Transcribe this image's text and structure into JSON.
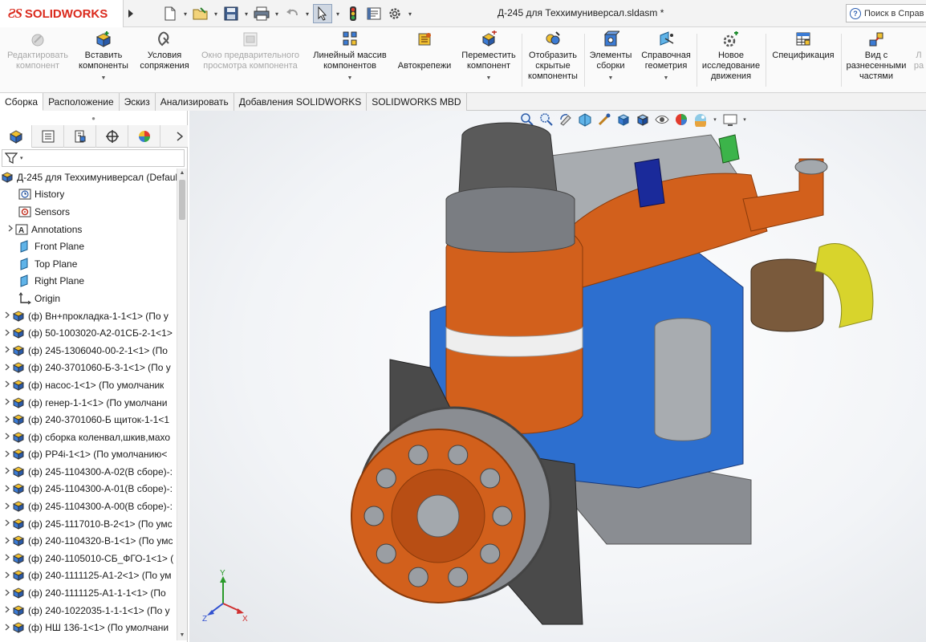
{
  "app": {
    "logo_mark": "ƧS",
    "logo_text": "SOLIDWORKS",
    "document_title": "Д-245 для Теххимуниверсал.sldasm *",
    "help_search_placeholder": "Поиск в Справ"
  },
  "quick_access": {
    "icons": [
      "new-document-icon",
      "open-folder-icon",
      "save-icon",
      "print-icon",
      "undo-icon",
      "select-pointer-icon",
      "rebuild-icon",
      "file-properties-icon",
      "options-gear-icon"
    ]
  },
  "ribbon": {
    "buttons": [
      {
        "label": "Редактировать\nкомпонент",
        "icon": "edit-component-icon",
        "enabled": false,
        "dropdown": false
      },
      {
        "label": "Вставить\nкомпоненты",
        "icon": "insert-components-icon",
        "enabled": true,
        "dropdown": true
      },
      {
        "label": "Условия\nсопряжения",
        "icon": "mate-icon",
        "enabled": true,
        "dropdown": false
      },
      {
        "label": "Окно предварительного\nпросмотра компонента",
        "icon": "component-preview-icon",
        "enabled": false,
        "dropdown": false
      },
      {
        "label": "Линейный массив\nкомпонентов",
        "icon": "linear-pattern-icon",
        "enabled": true,
        "dropdown": true
      },
      {
        "label": "Автокрепежи",
        "icon": "smart-fasteners-icon",
        "enabled": true,
        "dropdown": false
      },
      {
        "label": "Переместить\nкомпонент",
        "icon": "move-component-icon",
        "enabled": true,
        "dropdown": true
      },
      {
        "label": "Отобразить\nскрытые\nкомпоненты",
        "icon": "show-hidden-components-icon",
        "enabled": true,
        "dropdown": false
      },
      {
        "label": "Элементы\nсборки",
        "icon": "assembly-features-icon",
        "enabled": true,
        "dropdown": true
      },
      {
        "label": "Справочная\nгеометрия",
        "icon": "reference-geometry-icon",
        "enabled": true,
        "dropdown": true
      },
      {
        "label": "Новое\nисследование\nдвижения",
        "icon": "motion-study-icon",
        "enabled": true,
        "dropdown": false
      },
      {
        "label": "Спецификация",
        "icon": "bill-of-materials-icon",
        "enabled": true,
        "dropdown": false
      },
      {
        "label": "Вид с\nразнесенными\nчастями",
        "icon": "exploded-view-icon",
        "enabled": true,
        "dropdown": false
      },
      {
        "label": "Л\nра",
        "icon": "partial-tool-icon",
        "enabled": false,
        "dropdown": false
      }
    ]
  },
  "command_tabs": [
    {
      "label": "Сборка",
      "active": true
    },
    {
      "label": "Расположение",
      "active": false
    },
    {
      "label": "Эскиз",
      "active": false
    },
    {
      "label": "Анализировать",
      "active": false
    },
    {
      "label": "Добавления SOLIDWORKS",
      "active": false
    },
    {
      "label": "SOLIDWORKS MBD",
      "active": false
    }
  ],
  "manager_tabs": [
    "feature-manager-icon",
    "property-manager-icon",
    "configuration-manager-icon",
    "dimxpert-manager-icon",
    "display-manager-icon"
  ],
  "tree": {
    "root": "Д-245 для Теххимуниверсал  (Default",
    "items": [
      {
        "label": "History",
        "icon": "history-icon",
        "expandable": false
      },
      {
        "label": "Sensors",
        "icon": "sensors-icon",
        "expandable": false
      },
      {
        "label": "Annotations",
        "icon": "annotations-icon",
        "expandable": true
      },
      {
        "label": "Front Plane",
        "icon": "plane-icon",
        "expandable": false
      },
      {
        "label": "Top Plane",
        "icon": "plane-icon",
        "expandable": false
      },
      {
        "label": "Right Plane",
        "icon": "plane-icon",
        "expandable": false
      },
      {
        "label": "Origin",
        "icon": "origin-icon",
        "expandable": false
      },
      {
        "label": "(ф) Вн+прокладка-1-1<1> (По у",
        "icon": "component-icon",
        "expandable": true
      },
      {
        "label": "(ф) 50-1003020-А2-01СБ-2-1<1>",
        "icon": "component-icon",
        "expandable": true
      },
      {
        "label": "(ф) 245-1306040-00-2-1<1> (По",
        "icon": "component-icon",
        "expandable": true
      },
      {
        "label": "(ф) 240-3701060-Б-3-1<1> (По у",
        "icon": "component-icon",
        "expandable": true
      },
      {
        "label": "(ф) насос-1<1> (По умолчаник",
        "icon": "component-icon",
        "expandable": true
      },
      {
        "label": "(ф) генер-1-1<1> (По умолчани",
        "icon": "component-icon",
        "expandable": true
      },
      {
        "label": "(ф) 240-3701060-Б щиток-1-1<1",
        "icon": "component-icon",
        "expandable": true
      },
      {
        "label": "(ф) сборка коленвал,шкив,махо",
        "icon": "component-icon",
        "expandable": true
      },
      {
        "label": "(ф) PP4i-1<1> (По умолчанию<",
        "icon": "component-icon",
        "expandable": true
      },
      {
        "label": "(ф) 245-1104300-А-02(В сборе)-:",
        "icon": "component-icon",
        "expandable": true
      },
      {
        "label": "(ф) 245-1104300-А-01(В сборе)-:",
        "icon": "component-icon",
        "expandable": true
      },
      {
        "label": "(ф) 245-1104300-А-00(В сборе)-:",
        "icon": "component-icon",
        "expandable": true
      },
      {
        "label": "(ф) 245-1117010-В-2<1> (По умс",
        "icon": "component-icon",
        "expandable": true
      },
      {
        "label": "(ф) 240-1104320-В-1<1> (По умс",
        "icon": "component-icon",
        "expandable": true
      },
      {
        "label": "(ф) 240-1105010-СБ_ФГО-1<1> (",
        "icon": "component-icon",
        "expandable": true
      },
      {
        "label": "(ф) 240-1111125-А1-2<1> (По ум",
        "icon": "component-icon",
        "expandable": true
      },
      {
        "label": "(ф) 240-1111125-А1-1-1<1> (По",
        "icon": "component-icon",
        "expandable": true
      },
      {
        "label": "(ф) 240-1022035-1-1-1<1> (По у",
        "icon": "component-icon",
        "expandable": true
      },
      {
        "label": "(ф) НШ 136-1<1> (По умолчани",
        "icon": "component-icon",
        "expandable": true
      }
    ]
  },
  "viewport": {
    "background_top": "#ffffff",
    "model_colors": {
      "orange": "#d2601c",
      "blue": "#2d6fcf",
      "grey": "#a8acb0",
      "dark": "#5a5a5a",
      "yellow": "#d8d42c",
      "green": "#3cb44a",
      "navy": "#1a2a9a",
      "brown": "#7a5a3c"
    },
    "triad": {
      "x": "X",
      "y": "Y",
      "z": "Z"
    }
  }
}
